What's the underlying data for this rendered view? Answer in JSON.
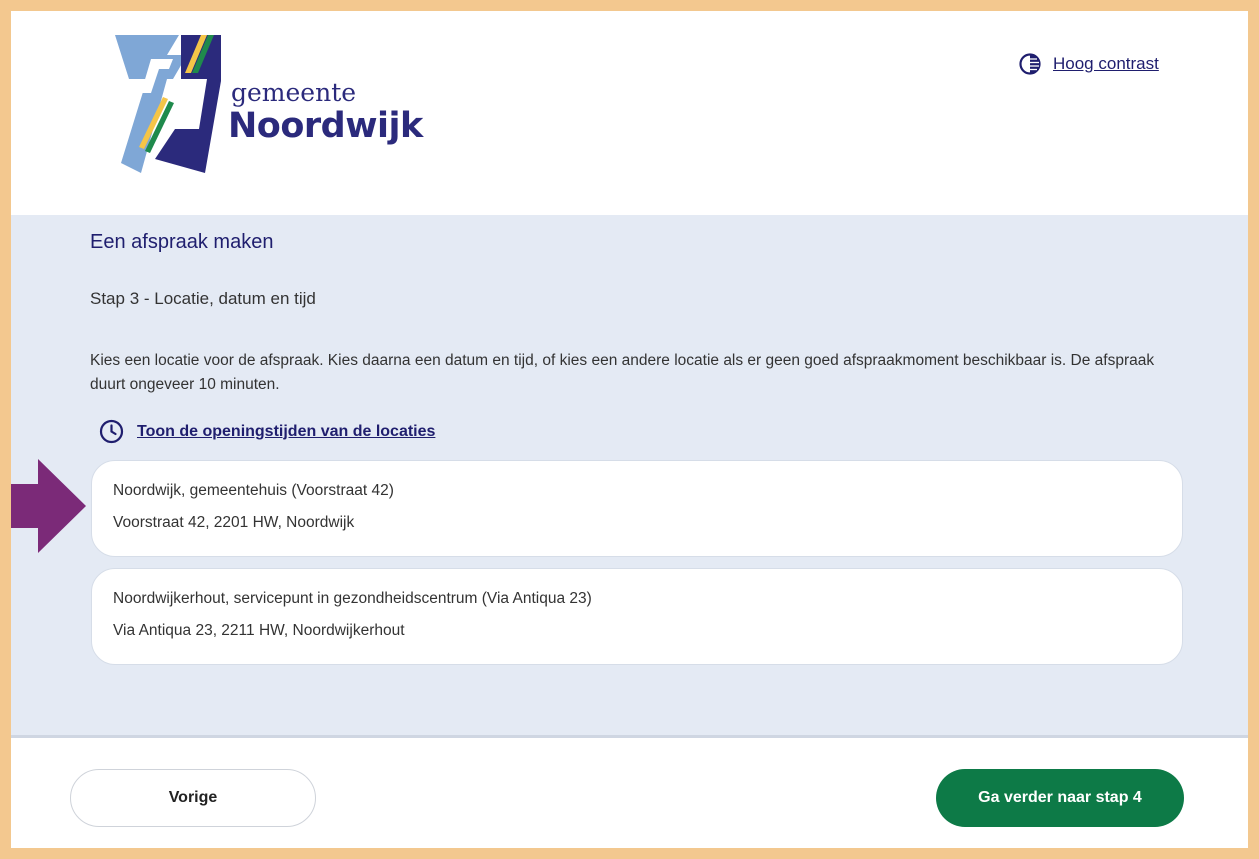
{
  "header": {
    "logo_small": "gemeente",
    "logo_big": "Noordwijk",
    "contrast_link": "Hoog contrast"
  },
  "main": {
    "title": "Een afspraak maken",
    "step": "Stap 3 - Locatie, datum en tijd",
    "description": "Kies een locatie voor de afspraak. Kies daarna een datum en tijd, of kies een andere locatie als er geen goed afspraakmoment beschikbaar is. De afspraak duurt ongeveer 10 minuten.",
    "hours_link": "Toon de openingstijden van de locaties",
    "locations": [
      {
        "name": "Noordwijk, gemeentehuis (Voorstraat 42)",
        "address": "Voorstraat 42, 2201 HW, Noordwijk"
      },
      {
        "name": "Noordwijkerhout, servicepunt in gezondheidscentrum (Via Antiqua 23)",
        "address": "Via Antiqua 23, 2211 HW, Noordwijkerhout"
      }
    ]
  },
  "footer": {
    "prev_label": "Vorige",
    "next_label": "Ga verder naar stap 4"
  },
  "colors": {
    "frame": "#f3c88f",
    "primary_text": "#1f1e6e",
    "panel_bg": "#e4eaf4",
    "next_button": "#0d7a47",
    "arrow": "#7b2a78"
  }
}
